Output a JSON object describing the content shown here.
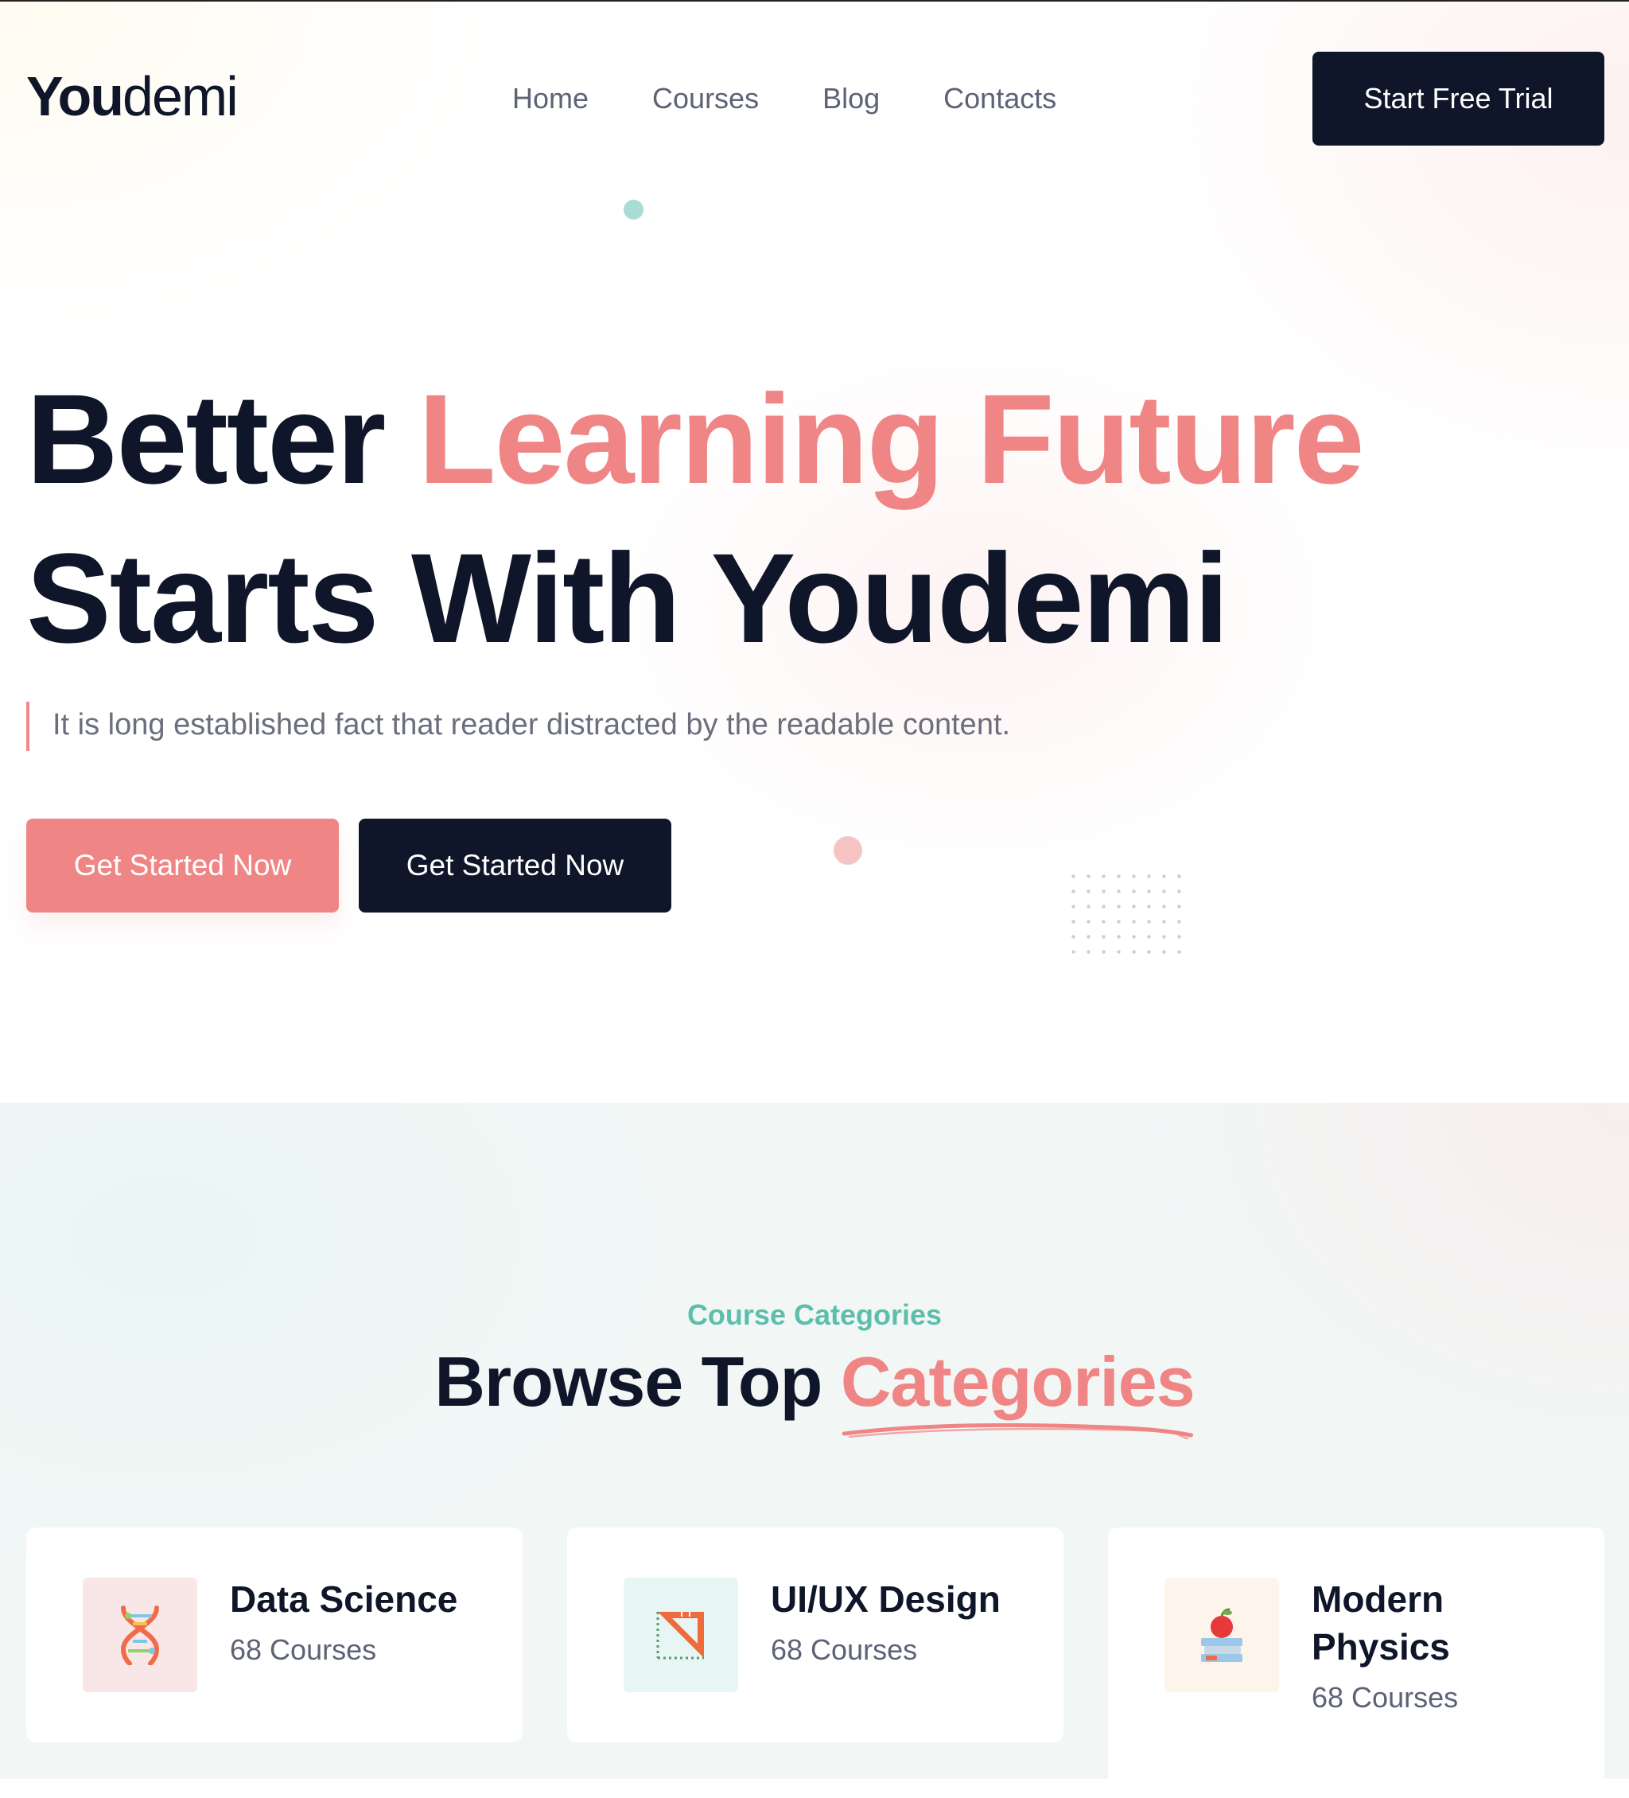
{
  "brand": {
    "logo_bold": "You",
    "logo_light": "demi"
  },
  "nav": {
    "items": [
      {
        "label": "Home"
      },
      {
        "label": "Courses"
      },
      {
        "label": "Blog"
      },
      {
        "label": "Contacts"
      }
    ],
    "cta_label": "Start Free Trial"
  },
  "hero": {
    "headline_part1": "Better ",
    "headline_accent": "Learning Future",
    "headline_part2": "Starts With Youdemi",
    "subtext": "It is long established fact that reader distracted by the readable content.",
    "primary_cta": "Get Started Now",
    "secondary_cta": "Get Started Now"
  },
  "categories": {
    "eyebrow": "Course Categories",
    "title_plain": "Browse Top ",
    "title_accent": "Categories",
    "items": [
      {
        "name": "Data Science",
        "count": "68 Courses",
        "icon": "dna-icon"
      },
      {
        "name": "UI/UX Design",
        "count": "68 Courses",
        "icon": "set-square-icon"
      },
      {
        "name": "Modern Physics",
        "count": "68 Courses",
        "icon": "books-apple-icon"
      }
    ]
  },
  "colors": {
    "navy": "#0f1629",
    "accent_pink": "#f08585",
    "accent_teal": "#5dbfab",
    "muted_text": "#5d6275"
  }
}
